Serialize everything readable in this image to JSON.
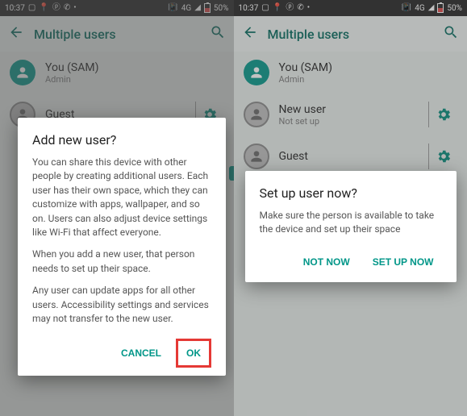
{
  "status": {
    "time": "10:37",
    "net": "4G",
    "battery": "50%"
  },
  "topbar": {
    "title": "Multiple users"
  },
  "left": {
    "users": [
      {
        "name": "You (SAM)",
        "sub": "Admin"
      },
      {
        "name": "Guest",
        "sub": ""
      }
    ],
    "dialog": {
      "title": "Add new user?",
      "p1": "You can share this device with other people by creating additional users. Each user has their own space, which they can customize with apps, wallpaper, and so on. Users can also adjust device settings like Wi-Fi that affect everyone.",
      "p2": "When you add a new user, that person needs to set up their space.",
      "p3": "Any user can update apps for all other users. Accessibility settings and services may not transfer to the new user.",
      "cancel": "CANCEL",
      "ok": "OK"
    }
  },
  "right": {
    "users": [
      {
        "name": "You (SAM)",
        "sub": "Admin"
      },
      {
        "name": "New user",
        "sub": "Not set up"
      },
      {
        "name": "Guest",
        "sub": ""
      }
    ],
    "dialog": {
      "title": "Set up user now?",
      "body": "Make sure the person is available to take the device and set up their space",
      "not_now": "NOT NOW",
      "setup": "SET UP NOW"
    }
  }
}
